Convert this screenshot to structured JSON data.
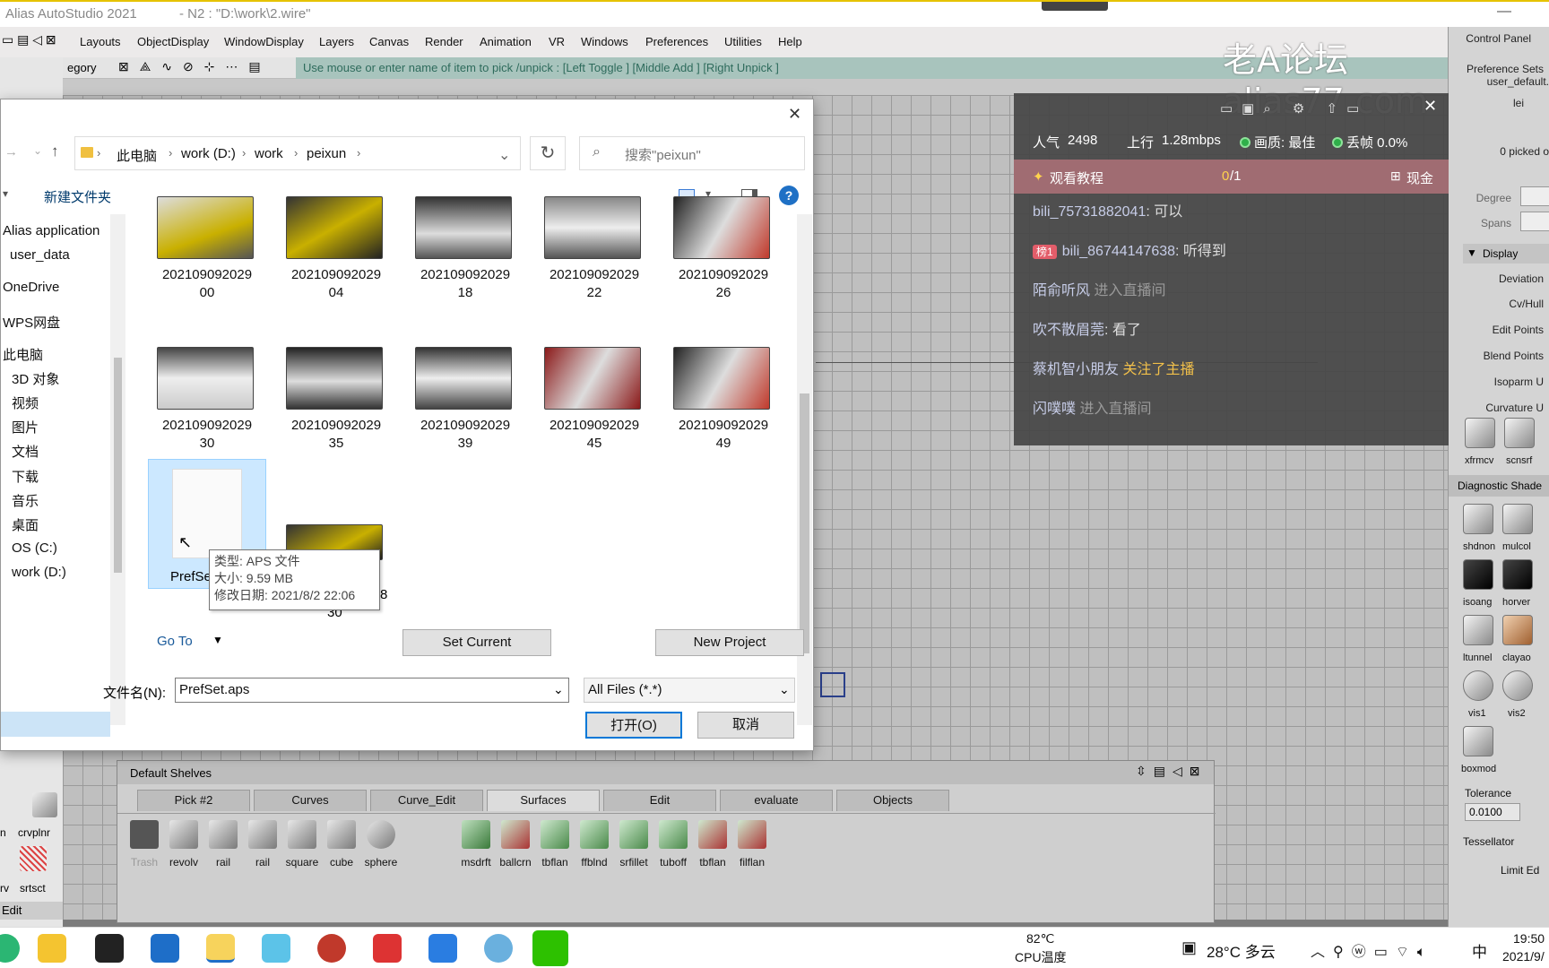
{
  "window": {
    "title": "Alias AutoStudio 2021",
    "subtitle": "- N2 : \"D:\\work\\2.wire\"",
    "min": "—",
    "max": "□"
  },
  "menu": [
    "Layouts",
    "ObjectDisplay",
    "WindowDisplay",
    "Layers",
    "Canvas",
    "Render",
    "Animation",
    "VR",
    "Windows",
    "Preferences",
    "Utilities",
    "Help"
  ],
  "toolbar": {
    "category": "egory",
    "pick_message": "Use mouse or enter name of item to pick /unpick : [Left Toggle ] [Middle Add ] [Right Unpick ]"
  },
  "watermark": "老A论坛alias77.com",
  "control_panel": {
    "title": "Control Panel",
    "preset": "Preference Sets",
    "user": "user_default.",
    "lei": "lei",
    "picked": "0 picked o",
    "degree": "Degree",
    "spans": "Spans",
    "display": "Display",
    "rows": [
      "Deviation",
      "Cv/Hull",
      "Edit Points",
      "Blend Points",
      "Isoparm U",
      "Curvature U"
    ],
    "tools1": [
      "xfrmcv",
      "scnsrf"
    ],
    "diag": "Diagnostic Shade",
    "tools2": [
      "shdnon",
      "mulcol",
      "isoang",
      "horver",
      "ltunnel",
      "clayao",
      "vis1",
      "vis2",
      "boxmod"
    ],
    "tolerance": "Tolerance",
    "tol_value": "0.0100",
    "tessellator": "Tessellator",
    "limit": "Limit Ed"
  },
  "live": {
    "popularity_label": "人气",
    "popularity": "2498",
    "upload_label": "上行",
    "upload": "1.28mbps",
    "quality": "画质: 最佳",
    "drop": "丢帧 0.0%",
    "task": "观看教程",
    "task_progress_a": "0",
    "task_progress_b": "/1",
    "cash": "现金",
    "chat": [
      {
        "user": "bili_75731882041",
        "text": ": 可以"
      },
      {
        "badge": "榜1",
        "user": "bili_86744147638",
        "text": ": 听得到"
      },
      {
        "user": "陌俞听风",
        "note": " 进入直播间"
      },
      {
        "user": "吹不散眉莞",
        "text": ": 看了"
      },
      {
        "user": "蔡机智小朋友",
        "highlight": " 关注了主播"
      },
      {
        "user": "闪噗噗",
        "note": " 进入直播间"
      }
    ]
  },
  "dialog": {
    "close": "✕",
    "path": [
      "此电脑",
      "work (D:)",
      "work",
      "peixun"
    ],
    "search_placeholder": "搜索\"peixun\"",
    "new_folder": "新建文件夹",
    "help": "?",
    "nav": [
      "Alias application",
      "user_data",
      "OneDrive",
      "WPS网盘",
      "此电脑",
      "3D 对象",
      "视频",
      "图片",
      "文档",
      "下载",
      "音乐",
      "桌面",
      "OS (C:)",
      "work (D:)"
    ],
    "files": [
      {
        "l1": "202109092029",
        "l2": "00"
      },
      {
        "l1": "202109092029",
        "l2": "04"
      },
      {
        "l1": "202109092029",
        "l2": "18"
      },
      {
        "l1": "202109092029",
        "l2": "22"
      },
      {
        "l1": "202109092029",
        "l2": "26"
      },
      {
        "l1": "202109092029",
        "l2": "30"
      },
      {
        "l1": "202109092029",
        "l2": "35"
      },
      {
        "l1": "202109092029",
        "l2": "39"
      },
      {
        "l1": "202109092029",
        "l2": "45"
      },
      {
        "l1": "202109092029",
        "l2": "49"
      }
    ],
    "pref_file": "PrefSe",
    "last_file_tail": "8",
    "last_file_l2": "30",
    "tooltip": {
      "type": "类型: APS 文件",
      "size": "大小: 9.59 MB",
      "date": "修改日期: 2021/8/2 22:06"
    },
    "goto": "Go To",
    "set_current": "Set Current",
    "new_project": "New Project",
    "filename_label": "文件名(N):",
    "filename": "PrefSet.aps",
    "filter": "All Files (*.*)",
    "open": "打开(O)",
    "cancel": "取消"
  },
  "left_tools": [
    "crvplnr",
    "srtsct",
    "n",
    "rv",
    "Edit"
  ],
  "shelves": {
    "title": "Default Shelves",
    "tabs": [
      "Pick #2",
      "Curves",
      "Curve_Edit",
      "Surfaces",
      "Edit",
      "evaluate",
      "Objects"
    ],
    "items": [
      "Trash",
      "revolv",
      "rail",
      "rail",
      "square",
      "cube",
      "sphere",
      "msdrft",
      "ballcrn",
      "tbflan",
      "ffblnd",
      "srfillet",
      "tuboff",
      "tbflan",
      "filflan"
    ]
  },
  "taskbar": {
    "cpu_temp": "82℃",
    "cpu_label": "CPU温度",
    "weather": "28°C 多云",
    "ime": "中",
    "time": "19:50",
    "date": "2021/9/"
  }
}
